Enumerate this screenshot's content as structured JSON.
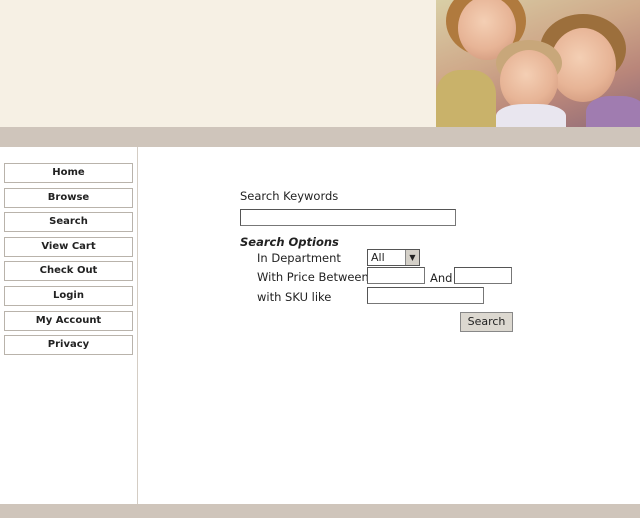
{
  "nav": {
    "items": [
      {
        "label": "Home"
      },
      {
        "label": "Browse"
      },
      {
        "label": "Search"
      },
      {
        "label": "View Cart"
      },
      {
        "label": "Check Out"
      },
      {
        "label": "Login"
      },
      {
        "label": "My Account"
      },
      {
        "label": "Privacy"
      }
    ]
  },
  "search": {
    "keywords_label": "Search Keywords",
    "keywords_value": "",
    "options_title": "Search Options",
    "department_label": "In Department",
    "department_selected": "All",
    "price_label": "With Price Between",
    "price_and_label": "And",
    "price_min": "",
    "price_max": "",
    "sku_label": "with SKU like",
    "sku_value": "",
    "button_label": "Search"
  },
  "colors": {
    "header_bg": "#f6f0e4",
    "band": "#cfc5bb"
  }
}
